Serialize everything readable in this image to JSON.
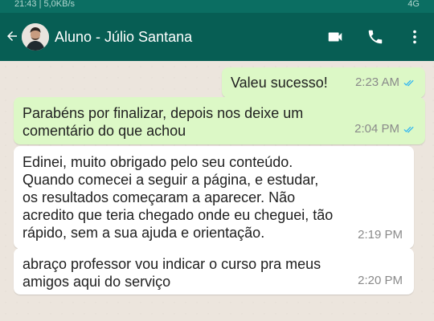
{
  "status_bar": {
    "left": "21:43 | 5,0KB/s",
    "right": "4G"
  },
  "header": {
    "title": "Aluno - Júlio Santana",
    "icons": [
      "back-arrow-icon",
      "video-call-icon",
      "phone-icon",
      "more-options-icon"
    ]
  },
  "messages": [
    {
      "direction": "outgoing",
      "text": "Valeu sucesso!",
      "time": "2:23 AM",
      "read": true
    },
    {
      "direction": "outgoing",
      "text": "Parabéns por finalizar, depois nos deixe um\ncomentário do que achou",
      "time": "2:04 PM",
      "read": true
    },
    {
      "direction": "incoming",
      "text": "Edinei, muito obrigado pelo seu conteúdo.\nQuando comecei a seguir a página, e estudar,\nos resultados começaram a aparecer. Não\nacredito que teria chegado onde eu cheguei, tão\nrápido, sem a sua ajuda e orientação.",
      "time": "2:19 PM"
    },
    {
      "direction": "incoming",
      "text": "abraço professor vou indicar o curso pra meus\namigos aqui do serviço",
      "time": "2:20 PM"
    }
  ],
  "colors": {
    "header": "#075e54",
    "outgoing_bubble": "#dcf8c6",
    "incoming_bubble": "#ffffff",
    "chat_background": "#ece5dd",
    "read_ticks": "#34b7f1"
  }
}
